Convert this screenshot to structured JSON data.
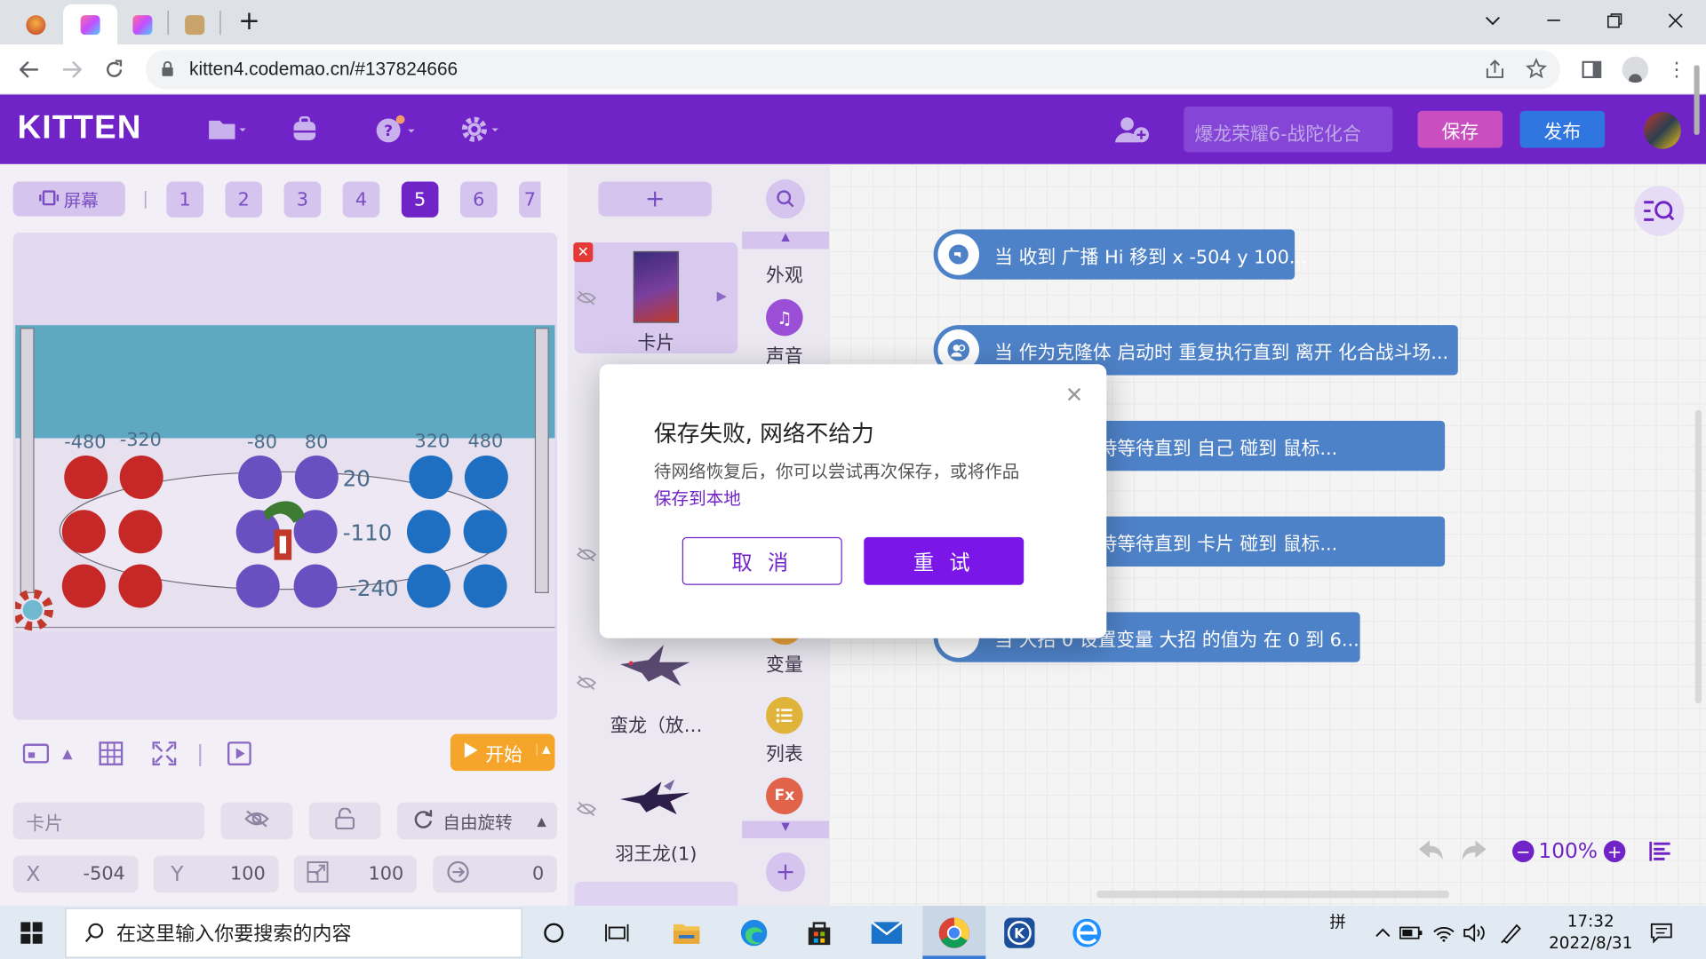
{
  "browser": {
    "url": "kitten4.codemao.cn/#137824666",
    "tabs": [
      {
        "icon": "app-favicon"
      },
      {
        "icon": "kitten-favicon"
      },
      {
        "icon": "kitten-favicon"
      },
      {
        "icon": "profile-favicon"
      }
    ]
  },
  "app": {
    "logo": "KITTEN",
    "project_name": "爆龙荣耀6-战陀化合",
    "save_label": "保存",
    "publish_label": "发布",
    "accent": "#7024c8"
  },
  "stage": {
    "screen_label": "屏幕",
    "pages": [
      "1",
      "2",
      "3",
      "4",
      "5",
      "6",
      "7"
    ],
    "active_page": "5",
    "axis_labels": {
      "x_left": [
        "-480",
        "-320"
      ],
      "x_mid": [
        "-80",
        "80"
      ],
      "x_right": [
        "320",
        "480"
      ],
      "y": [
        "20",
        "-110",
        "-240"
      ]
    },
    "start_label": "开始"
  },
  "properties": {
    "sprite_name": "卡片",
    "rotation_label": "自由旋转",
    "x_label": "X",
    "x_value": "-504",
    "y_label": "Y",
    "y_value": "100",
    "size_value": "100",
    "direction_value": "0"
  },
  "sprites": [
    {
      "name": "卡片"
    },
    {
      "name": "蛮龙（放…"
    },
    {
      "name": "羽王龙(1)"
    }
  ],
  "categories": [
    {
      "label": "外观",
      "icon": "eye-icon"
    },
    {
      "label": "声音",
      "icon": "music-icon"
    },
    {
      "label": "变量",
      "icon": "variable-icon"
    },
    {
      "label": "列表",
      "icon": "list-icon"
    },
    {
      "label": "函数",
      "icon": "function-icon"
    }
  ],
  "code_blocks": [
    {
      "text": "当 收到 广播 Hi 移到 x -504 y 100..."
    },
    {
      "text": "当 作为克隆体 启动时 重复执行直到 离开 化合战斗场..."
    },
    {
      "text": "体 启动时 保持等待直到 自己 碰到 鼠标..."
    },
    {
      "text": "体 启动时 保持等待直到 卡片 碰到 鼠标..."
    },
    {
      "text": "当 大招 0 设置变量 大招 的值为 在 0 到 6..."
    }
  ],
  "zoom": {
    "value": "100%"
  },
  "dialog": {
    "title": "保存失败, 网络不给力",
    "message": "待网络恢复后，你可以尝试再次保存，或将作品",
    "link": "保存到本地",
    "cancel": "取 消",
    "retry": "重 试"
  },
  "taskbar": {
    "search_placeholder": "在这里输入你要搜索的内容",
    "ime": "拼",
    "time": "17:32",
    "date": "2022/8/31"
  }
}
